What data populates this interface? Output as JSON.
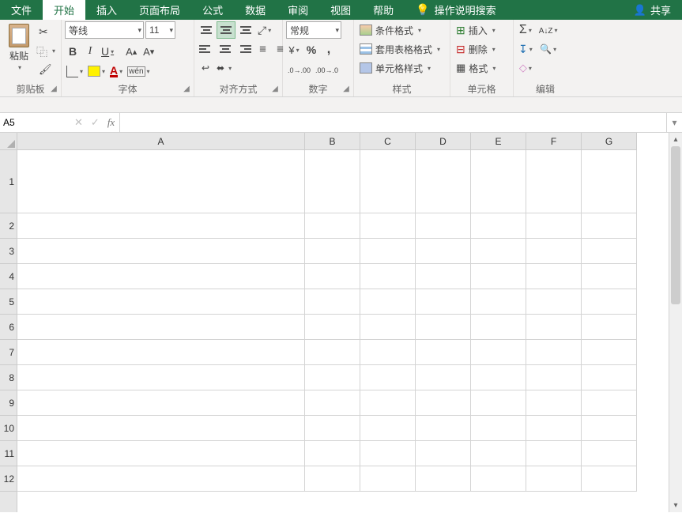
{
  "menu": {
    "file": "文件",
    "home": "开始",
    "insert": "插入",
    "layout": "页面布局",
    "formulas": "公式",
    "data": "数据",
    "review": "审阅",
    "view": "视图",
    "help": "帮助",
    "tellme": "操作说明搜索",
    "share": "共享"
  },
  "ribbon": {
    "clipboard": {
      "label": "剪贴板",
      "paste": "粘贴"
    },
    "font": {
      "label": "字体",
      "name": "等线",
      "size": "11"
    },
    "alignment": {
      "label": "对齐方式"
    },
    "number": {
      "label": "数字",
      "format": "常规"
    },
    "styles": {
      "label": "样式",
      "conditional": "条件格式",
      "table": "套用表格格式",
      "cell": "单元格样式"
    },
    "cells": {
      "label": "单元格",
      "insert": "插入",
      "delete": "删除",
      "format": "格式"
    },
    "editing": {
      "label": "编辑"
    }
  },
  "namebox": {
    "value": "A5"
  },
  "formula": {
    "value": ""
  },
  "columns": [
    "A",
    "B",
    "C",
    "D",
    "E",
    "F",
    "G"
  ],
  "rows": [
    "1",
    "2",
    "3",
    "4",
    "5",
    "6",
    "7",
    "8",
    "9",
    "10",
    "11",
    "12"
  ]
}
